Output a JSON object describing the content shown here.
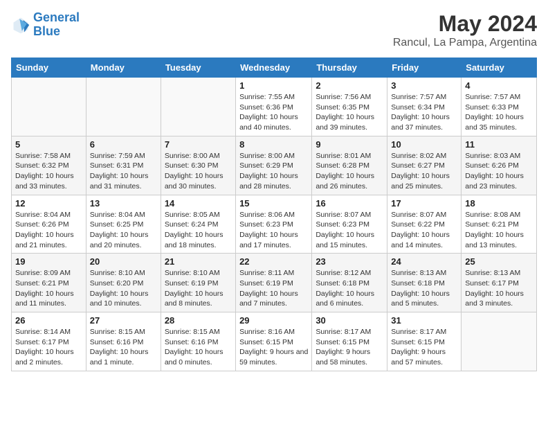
{
  "logo": {
    "line1": "General",
    "line2": "Blue"
  },
  "title": "May 2024",
  "subtitle": "Rancul, La Pampa, Argentina",
  "days_of_week": [
    "Sunday",
    "Monday",
    "Tuesday",
    "Wednesday",
    "Thursday",
    "Friday",
    "Saturday"
  ],
  "weeks": [
    [
      {
        "day": "",
        "info": ""
      },
      {
        "day": "",
        "info": ""
      },
      {
        "day": "",
        "info": ""
      },
      {
        "day": "1",
        "info": "Sunrise: 7:55 AM\nSunset: 6:36 PM\nDaylight: 10 hours and 40 minutes."
      },
      {
        "day": "2",
        "info": "Sunrise: 7:56 AM\nSunset: 6:35 PM\nDaylight: 10 hours and 39 minutes."
      },
      {
        "day": "3",
        "info": "Sunrise: 7:57 AM\nSunset: 6:34 PM\nDaylight: 10 hours and 37 minutes."
      },
      {
        "day": "4",
        "info": "Sunrise: 7:57 AM\nSunset: 6:33 PM\nDaylight: 10 hours and 35 minutes."
      }
    ],
    [
      {
        "day": "5",
        "info": "Sunrise: 7:58 AM\nSunset: 6:32 PM\nDaylight: 10 hours and 33 minutes."
      },
      {
        "day": "6",
        "info": "Sunrise: 7:59 AM\nSunset: 6:31 PM\nDaylight: 10 hours and 31 minutes."
      },
      {
        "day": "7",
        "info": "Sunrise: 8:00 AM\nSunset: 6:30 PM\nDaylight: 10 hours and 30 minutes."
      },
      {
        "day": "8",
        "info": "Sunrise: 8:00 AM\nSunset: 6:29 PM\nDaylight: 10 hours and 28 minutes."
      },
      {
        "day": "9",
        "info": "Sunrise: 8:01 AM\nSunset: 6:28 PM\nDaylight: 10 hours and 26 minutes."
      },
      {
        "day": "10",
        "info": "Sunrise: 8:02 AM\nSunset: 6:27 PM\nDaylight: 10 hours and 25 minutes."
      },
      {
        "day": "11",
        "info": "Sunrise: 8:03 AM\nSunset: 6:26 PM\nDaylight: 10 hours and 23 minutes."
      }
    ],
    [
      {
        "day": "12",
        "info": "Sunrise: 8:04 AM\nSunset: 6:26 PM\nDaylight: 10 hours and 21 minutes."
      },
      {
        "day": "13",
        "info": "Sunrise: 8:04 AM\nSunset: 6:25 PM\nDaylight: 10 hours and 20 minutes."
      },
      {
        "day": "14",
        "info": "Sunrise: 8:05 AM\nSunset: 6:24 PM\nDaylight: 10 hours and 18 minutes."
      },
      {
        "day": "15",
        "info": "Sunrise: 8:06 AM\nSunset: 6:23 PM\nDaylight: 10 hours and 17 minutes."
      },
      {
        "day": "16",
        "info": "Sunrise: 8:07 AM\nSunset: 6:23 PM\nDaylight: 10 hours and 15 minutes."
      },
      {
        "day": "17",
        "info": "Sunrise: 8:07 AM\nSunset: 6:22 PM\nDaylight: 10 hours and 14 minutes."
      },
      {
        "day": "18",
        "info": "Sunrise: 8:08 AM\nSunset: 6:21 PM\nDaylight: 10 hours and 13 minutes."
      }
    ],
    [
      {
        "day": "19",
        "info": "Sunrise: 8:09 AM\nSunset: 6:21 PM\nDaylight: 10 hours and 11 minutes."
      },
      {
        "day": "20",
        "info": "Sunrise: 8:10 AM\nSunset: 6:20 PM\nDaylight: 10 hours and 10 minutes."
      },
      {
        "day": "21",
        "info": "Sunrise: 8:10 AM\nSunset: 6:19 PM\nDaylight: 10 hours and 8 minutes."
      },
      {
        "day": "22",
        "info": "Sunrise: 8:11 AM\nSunset: 6:19 PM\nDaylight: 10 hours and 7 minutes."
      },
      {
        "day": "23",
        "info": "Sunrise: 8:12 AM\nSunset: 6:18 PM\nDaylight: 10 hours and 6 minutes."
      },
      {
        "day": "24",
        "info": "Sunrise: 8:13 AM\nSunset: 6:18 PM\nDaylight: 10 hours and 5 minutes."
      },
      {
        "day": "25",
        "info": "Sunrise: 8:13 AM\nSunset: 6:17 PM\nDaylight: 10 hours and 3 minutes."
      }
    ],
    [
      {
        "day": "26",
        "info": "Sunrise: 8:14 AM\nSunset: 6:17 PM\nDaylight: 10 hours and 2 minutes."
      },
      {
        "day": "27",
        "info": "Sunrise: 8:15 AM\nSunset: 6:16 PM\nDaylight: 10 hours and 1 minute."
      },
      {
        "day": "28",
        "info": "Sunrise: 8:15 AM\nSunset: 6:16 PM\nDaylight: 10 hours and 0 minutes."
      },
      {
        "day": "29",
        "info": "Sunrise: 8:16 AM\nSunset: 6:15 PM\nDaylight: 9 hours and 59 minutes."
      },
      {
        "day": "30",
        "info": "Sunrise: 8:17 AM\nSunset: 6:15 PM\nDaylight: 9 hours and 58 minutes."
      },
      {
        "day": "31",
        "info": "Sunrise: 8:17 AM\nSunset: 6:15 PM\nDaylight: 9 hours and 57 minutes."
      },
      {
        "day": "",
        "info": ""
      }
    ]
  ]
}
